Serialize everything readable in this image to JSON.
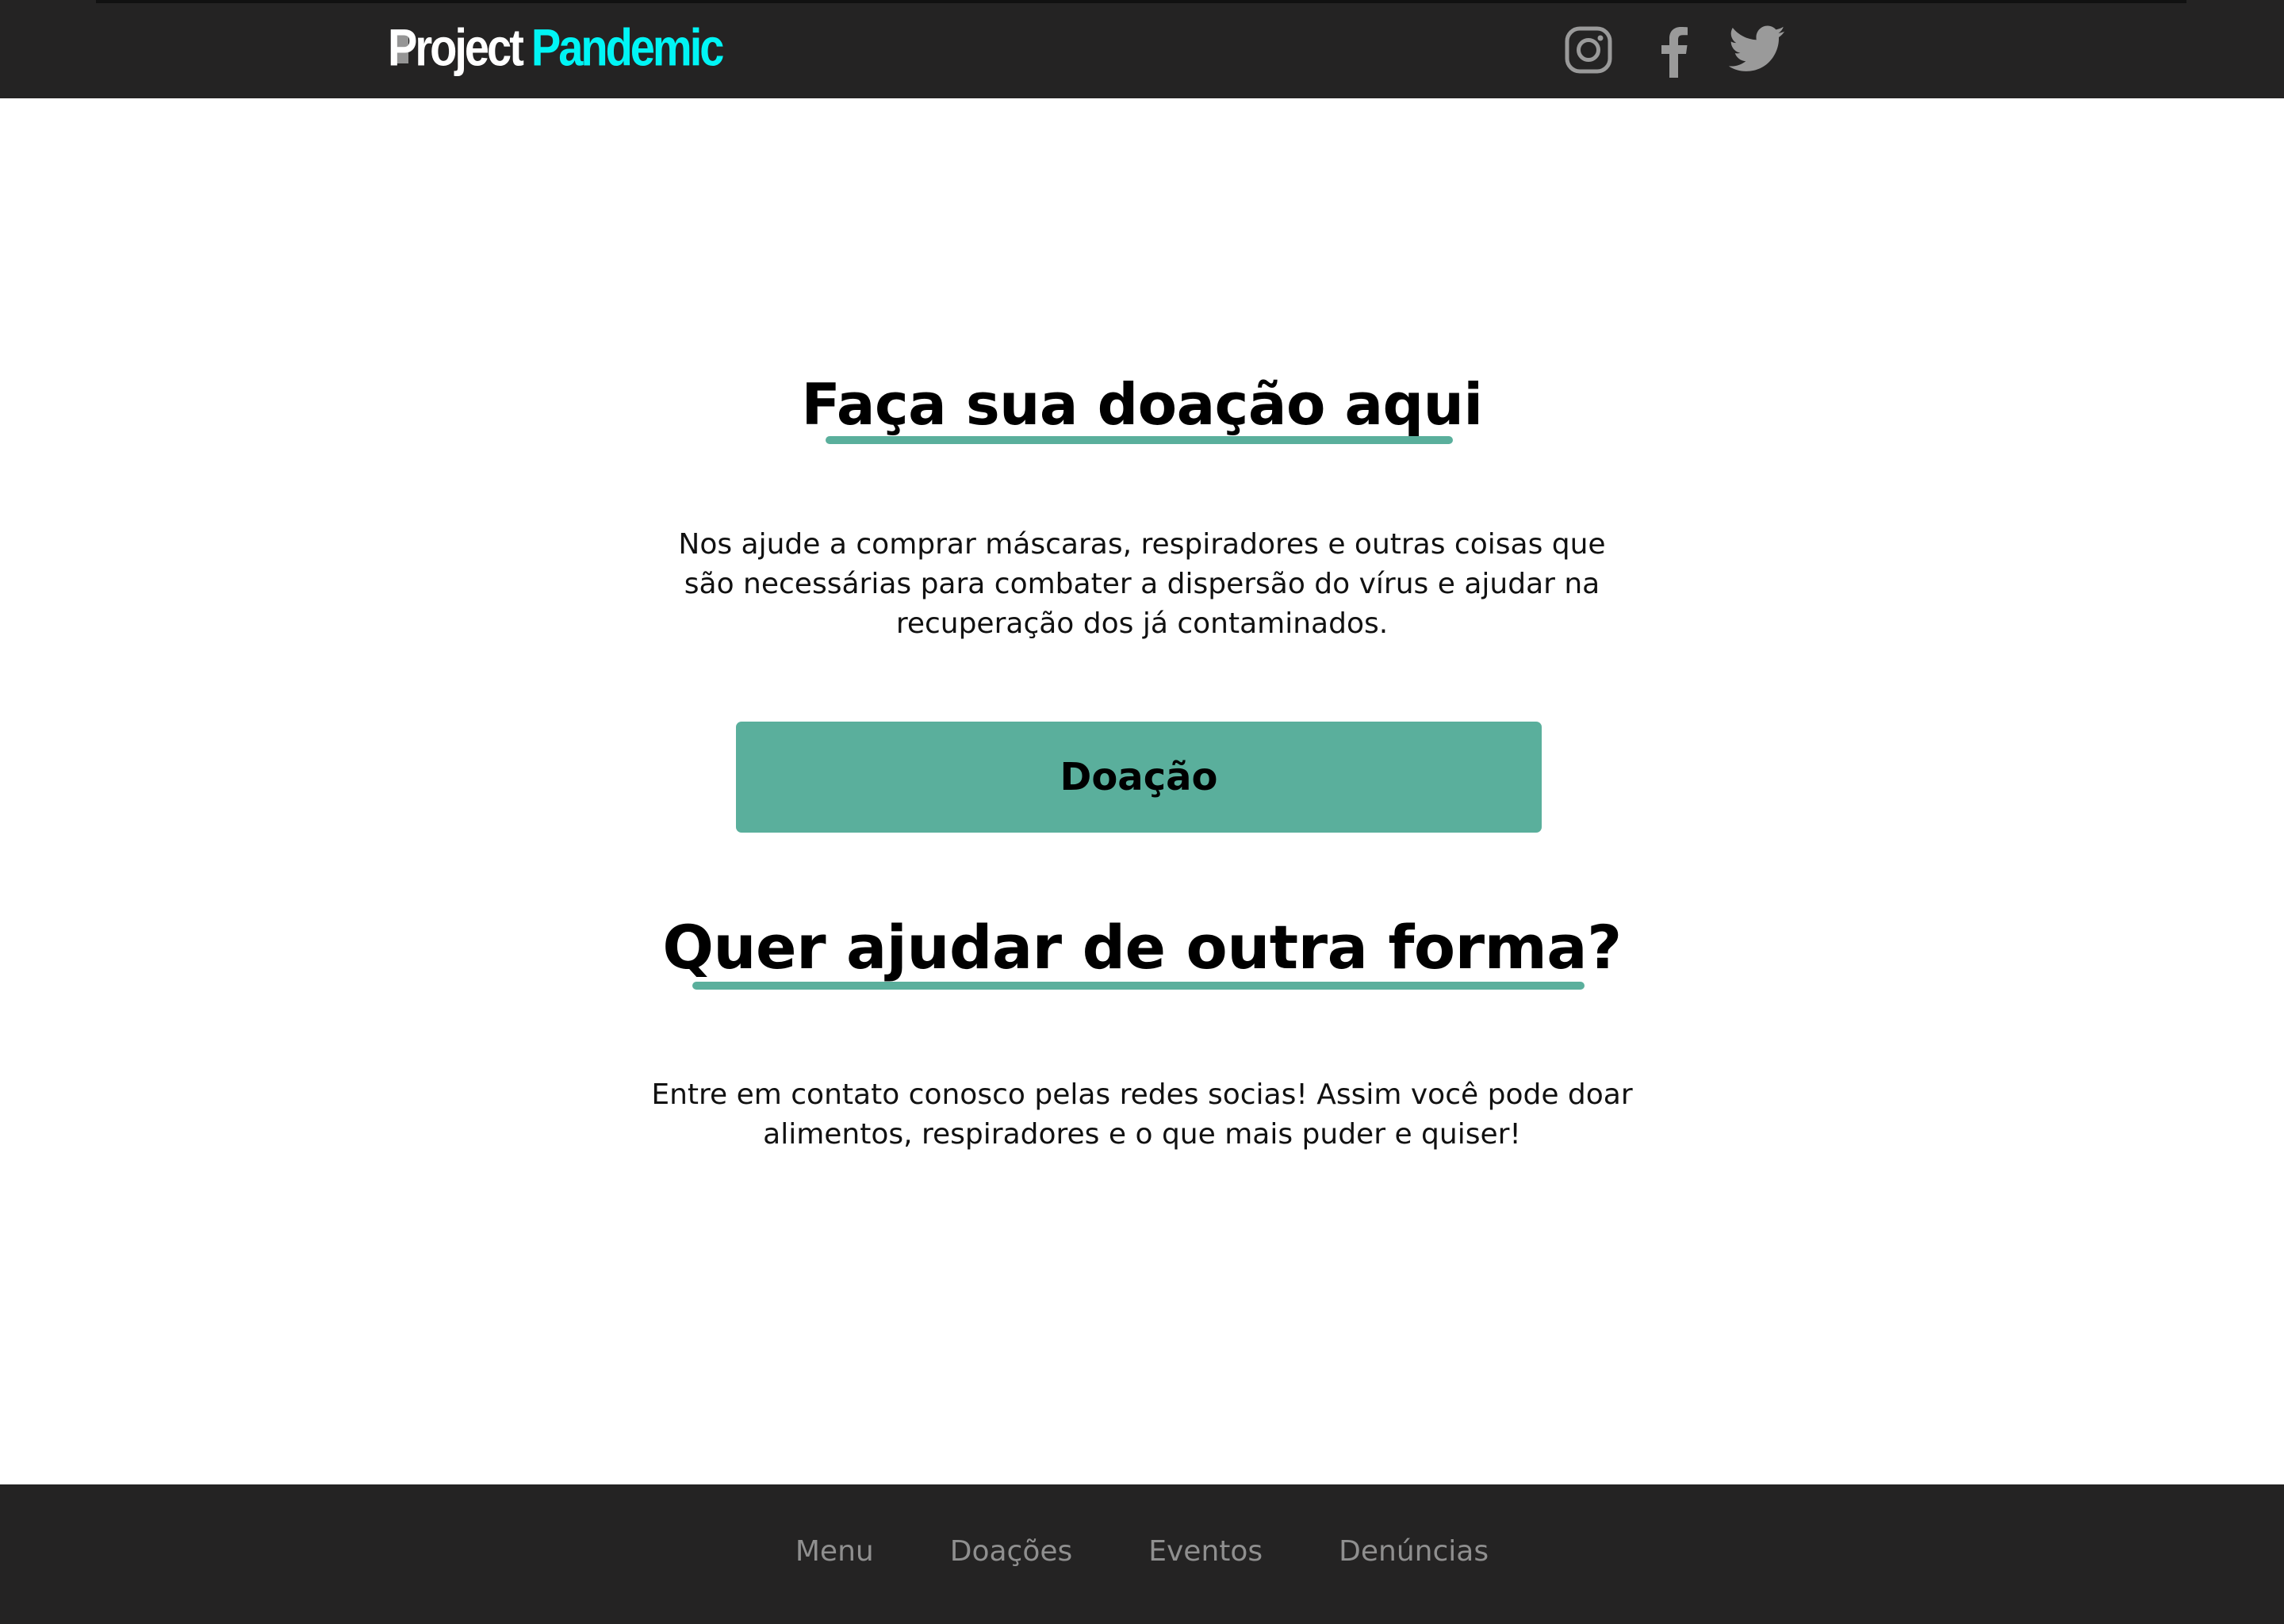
{
  "header": {
    "logo": {
      "word1": "Project",
      "word2": "Pandemic"
    },
    "social": [
      {
        "icon": "instagram-icon"
      },
      {
        "icon": "facebook-icon"
      },
      {
        "icon": "twitter-icon"
      }
    ]
  },
  "main": {
    "donate_section": {
      "heading": "Faça sua doação aqui",
      "text": "Nos ajude a comprar máscaras, respiradores e outras coisas que são necessárias para combater a dispersão do vírus e ajudar na recuperação dos já contaminados.",
      "button_label": "Doação"
    },
    "help_section": {
      "heading": "Quer ajudar de outra forma?",
      "text": "Entre em contato conosco pelas redes socias! Assim você pode doar alimentos, respiradores e o que mais puder e quiser!"
    }
  },
  "footer": {
    "nav": [
      {
        "label": "Menu"
      },
      {
        "label": "Doações"
      },
      {
        "label": "Eventos"
      },
      {
        "label": "Denúncias"
      }
    ]
  },
  "colors": {
    "header_bg": "#242323",
    "logo_accent": "#00f5f5",
    "accent": "#5aaf9c",
    "footer_link": "#8f8f8f"
  }
}
